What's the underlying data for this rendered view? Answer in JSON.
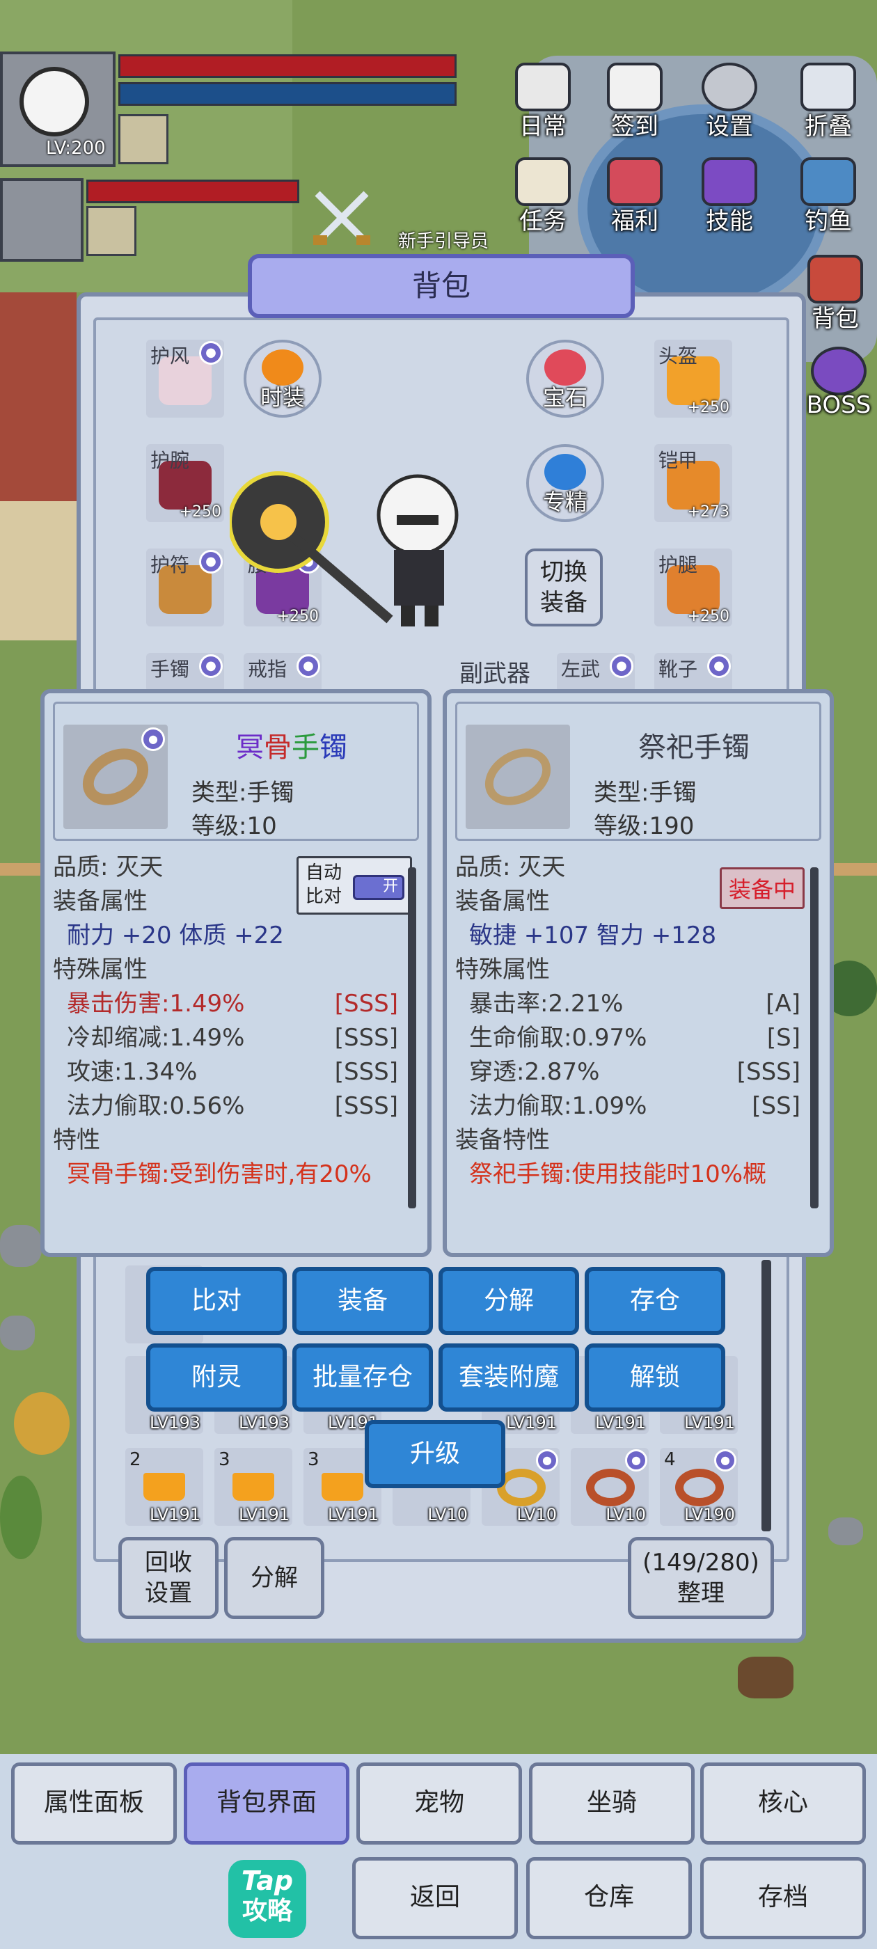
{
  "hud": {
    "player_level": "LV:200",
    "npc_label": "新手引导员",
    "top_menu": [
      "日常",
      "签到",
      "设置",
      "折叠"
    ],
    "second_menu": [
      "任务",
      "福利",
      "技能",
      "钓鱼"
    ],
    "side_labels": [
      "背包",
      "BOSS"
    ]
  },
  "bag": {
    "title": "背包",
    "equip_slots": [
      {
        "tag": "护风",
        "plus": "",
        "locked": true
      },
      {
        "tag": "头盔",
        "plus": "+250",
        "locked": false
      },
      {
        "tag": "护腕",
        "plus": "+250",
        "locked": false
      },
      {
        "tag": "铠甲",
        "plus": "+273",
        "locked": false
      },
      {
        "tag": "护符",
        "plus": "",
        "locked": true
      },
      {
        "tag": "腰带",
        "plus": "+250",
        "locked": true
      },
      {
        "tag": "护腿",
        "plus": "+250",
        "locked": false
      },
      {
        "tag": "手镯",
        "plus": "",
        "locked": true
      },
      {
        "tag": "戒指",
        "plus": "",
        "locked": true
      },
      {
        "tag": "左武",
        "plus": "",
        "locked": true
      },
      {
        "tag": "靴子",
        "plus": "",
        "locked": true
      }
    ],
    "fashion_label": "时装",
    "gem_label": "宝石",
    "mastery_label": "专精",
    "switch_label": "切换\n装备",
    "subweapon_label": "副武器"
  },
  "compare": {
    "auto_compare_label": "自动\n比对",
    "toggle_label": "开",
    "left": {
      "name_parts": [
        "冥",
        "骨",
        "手",
        "镯"
      ],
      "type": "类型:手镯",
      "level": "等级:10",
      "quality": "品质: 灭天",
      "attr_header": "装备属性",
      "attrs": "耐力 +20    体质 +22",
      "special_header": "特殊属性",
      "specials": [
        {
          "name": "暴击伤害:1.49%",
          "grade": "[SSS]",
          "red": true
        },
        {
          "name": "冷却缩减:1.49%",
          "grade": "[SSS]",
          "red": false
        },
        {
          "name": "攻速:1.34%",
          "grade": "[SSS]",
          "red": false
        },
        {
          "name": "法力偷取:0.56%",
          "grade": "[SSS]",
          "red": false
        }
      ],
      "trait_header": "特性",
      "trait": "冥骨手镯:受到伤害时,有20%"
    },
    "right": {
      "name": "祭祀手镯",
      "type": "类型:手镯",
      "level": "等级:190",
      "quality": "品质: 灭天",
      "equipped_badge": "装备中",
      "attr_header": "装备属性",
      "attrs": "敏捷 +107    智力 +128",
      "special_header": "特殊属性",
      "specials": [
        {
          "name": "暴击率:2.21%",
          "grade": "[A]"
        },
        {
          "name": "生命偷取:0.97%",
          "grade": "[S]"
        },
        {
          "name": "穿透:2.87%",
          "grade": "[SSS]"
        },
        {
          "name": "法力偷取:1.09%",
          "grade": "[SS]"
        }
      ],
      "trait_header": "装备特性",
      "trait": "祭祀手镯:使用技能时10%概"
    }
  },
  "actions": {
    "row1": [
      "比对",
      "装备",
      "分解",
      "存仓"
    ],
    "row2": [
      "附灵",
      "批量存仓",
      "套装附魔",
      "解锁"
    ],
    "upgrade": "升级"
  },
  "inventory": {
    "row1": [
      "LV193",
      "LV193",
      "LV191",
      "LV191",
      "LV191",
      "LV191"
    ],
    "row2": [
      {
        "n": "2",
        "lv": "LV191"
      },
      {
        "n": "3",
        "lv": "LV191"
      },
      {
        "n": "3",
        "lv": "LV191"
      },
      {
        "n": "",
        "lv": "LV10"
      },
      {
        "n": "",
        "lv": "LV10"
      },
      {
        "n": "",
        "lv": "LV10"
      },
      {
        "n": "4",
        "lv": "LV190"
      }
    ],
    "recycle_label": "回收\n设置",
    "decompose_label": "分解",
    "capacity": "(149/280)",
    "sort_label": "整理"
  },
  "nav": {
    "row1": [
      "属性面板",
      "背包界面",
      "宠物",
      "坐骑",
      "核心"
    ],
    "active": "背包界面",
    "row2": [
      "返回",
      "仓库",
      "存档"
    ],
    "tap_logo_top": "Tap",
    "tap_logo_bottom": "攻略"
  }
}
